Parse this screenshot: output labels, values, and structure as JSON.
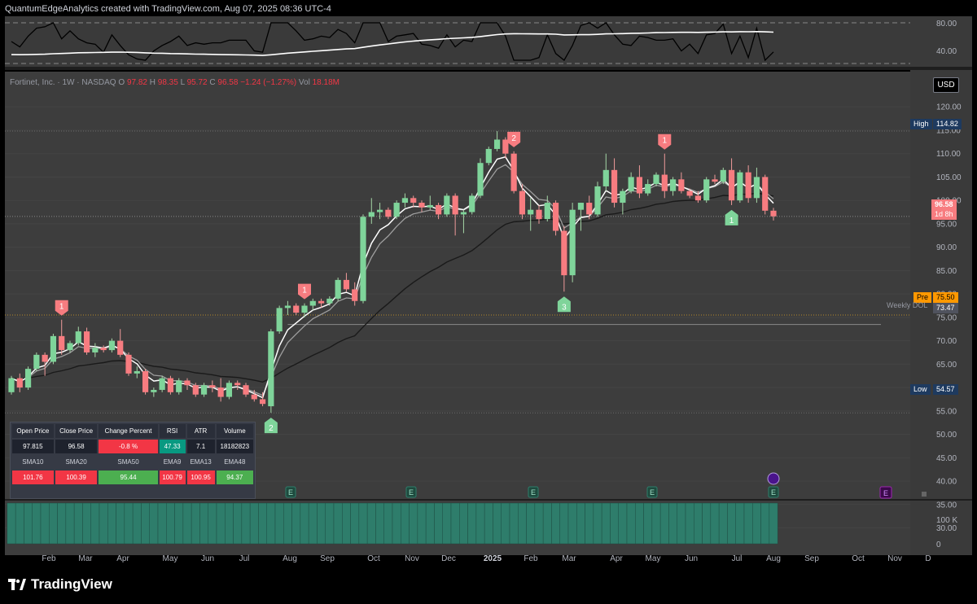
{
  "header": {
    "caption": "QuantumEdgeAnalytics created with TradingView.com, Aug 07, 2025 08:36 UTC-4"
  },
  "symbol": {
    "title": "Fortinet, Inc. · 1W · NASDAQ",
    "o_label": "O",
    "o_val": "97.82",
    "h_label": "H",
    "h_val": "98.35",
    "l_label": "L",
    "l_val": "95.72",
    "c_label": "C",
    "c_val": "96.58 −1.24 (−1.27%)",
    "vol_label": "Vol",
    "vol_val": "18.18M"
  },
  "currency": "USD",
  "price_labels": {
    "high_label": "High",
    "high_value": "114.82",
    "low_label": "Low",
    "low_value": "54.57",
    "last_value": "96.58",
    "last_countdown": "1d 8h",
    "pre_label": "Pre",
    "pre_value": "75.50",
    "dol_label": "Weekly DOL",
    "dol_value": "73.47"
  },
  "colors": {
    "up": "#4caf50",
    "down": "#f23645",
    "up_soft": "#7fd49a",
    "down_soft": "#f77c80",
    "ema_fast": "#ffffff",
    "ema_slow": "#9e9e9e",
    "sma_long": "#1a1a1a",
    "volume": "#2e7d6b",
    "high_box": "#1e3a5f"
  },
  "stats_table": {
    "headers": [
      "Open Price",
      "Close Price",
      "Change Percent",
      "RSI",
      "ATR",
      "Volume"
    ],
    "values": [
      "97.815",
      "96.58",
      "-0.8 %",
      "47.33",
      "7.1",
      "18182823"
    ],
    "ma_headers": [
      "SMA10",
      "SMA20",
      "SMA50",
      "EMA9",
      "EMA13",
      "EMA48"
    ],
    "ma_values": [
      "101.76",
      "100.39",
      "95.44",
      "100.79",
      "100.95",
      "94.37"
    ]
  },
  "brand": "TradingView",
  "chart_data": {
    "type": "candlestick",
    "title": "Fortinet, Inc. · 1W · NASDAQ",
    "y_ticks": [
      30,
      35,
      40,
      45,
      50,
      55,
      60,
      65,
      70,
      75,
      80,
      85,
      90,
      95,
      100,
      105,
      110,
      115,
      120
    ],
    "ylim": [
      28,
      123
    ],
    "x_labels": [
      "Feb",
      "Mar",
      "Apr",
      "May",
      "Jun",
      "Jul",
      "Aug",
      "Sep",
      "Oct",
      "Nov",
      "Dec",
      "2025",
      "Feb",
      "Mar",
      "Apr",
      "May",
      "Jun",
      "Jul",
      "Aug",
      "Sep",
      "Oct",
      "Nov",
      "D"
    ],
    "volume_axis": [
      "100 K",
      "0"
    ],
    "indicator_axis": [
      "80.00",
      "40.00"
    ],
    "candles": [
      [
        59.0,
        62.5,
        58.5,
        62.0
      ],
      [
        62.0,
        63.0,
        59.0,
        60.0
      ],
      [
        60.0,
        64.5,
        59.5,
        64.0
      ],
      [
        64.0,
        67.5,
        63.5,
        67.0
      ],
      [
        67.0,
        67.5,
        62.5,
        65.5
      ],
      [
        65.5,
        71.5,
        65.0,
        71.0
      ],
      [
        71.0,
        74.5,
        67.0,
        68.0
      ],
      [
        68.0,
        70.0,
        67.5,
        69.5
      ],
      [
        69.5,
        73.0,
        69.0,
        72.0
      ],
      [
        72.0,
        72.8,
        67.0,
        67.5
      ],
      [
        67.5,
        69.5,
        66.5,
        68.5
      ],
      [
        68.5,
        69.0,
        67.5,
        68.0
      ],
      [
        68.0,
        70.5,
        67.5,
        70.0
      ],
      [
        70.0,
        72.5,
        66.5,
        67.0
      ],
      [
        67.0,
        67.5,
        62.5,
        63.0
      ],
      [
        63.0,
        64.5,
        62.0,
        63.5
      ],
      [
        63.5,
        64.0,
        58.5,
        59.0
      ],
      [
        59.0,
        60.0,
        58.0,
        59.5
      ],
      [
        59.5,
        62.5,
        59.0,
        62.0
      ],
      [
        62.0,
        62.5,
        58.5,
        59.0
      ],
      [
        59.0,
        62.0,
        58.5,
        61.5
      ],
      [
        61.5,
        62.0,
        59.5,
        60.5
      ],
      [
        60.5,
        61.0,
        58.0,
        58.5
      ],
      [
        58.5,
        61.0,
        58.0,
        60.5
      ],
      [
        60.5,
        61.5,
        59.0,
        60.0
      ],
      [
        60.0,
        62.0,
        57.0,
        58.0
      ],
      [
        58.0,
        61.5,
        57.5,
        61.0
      ],
      [
        61.0,
        61.5,
        59.5,
        60.5
      ],
      [
        60.5,
        61.0,
        58.0,
        58.5
      ],
      [
        58.5,
        59.5,
        57.0,
        57.5
      ],
      [
        57.5,
        59.0,
        56.0,
        56.5
      ],
      [
        56.0,
        72.5,
        54.6,
        72.0
      ],
      [
        72.0,
        77.5,
        71.5,
        77.0
      ],
      [
        77.0,
        78.5,
        75.5,
        77.5
      ],
      [
        77.5,
        78.0,
        75.5,
        76.0
      ],
      [
        76.0,
        78.0,
        75.0,
        77.5
      ],
      [
        77.5,
        79.0,
        76.5,
        78.5
      ],
      [
        78.5,
        79.0,
        77.0,
        78.0
      ],
      [
        78.0,
        79.5,
        77.5,
        79.0
      ],
      [
        79.0,
        83.5,
        78.5,
        83.0
      ],
      [
        83.0,
        84.5,
        80.5,
        81.0
      ],
      [
        81.0,
        82.5,
        77.5,
        78.5
      ],
      [
        78.5,
        97.0,
        78.0,
        96.5
      ],
      [
        96.5,
        100.5,
        95.0,
        97.5
      ],
      [
        97.5,
        99.5,
        96.0,
        98.0
      ],
      [
        98.0,
        98.5,
        96.0,
        96.5
      ],
      [
        96.5,
        100.0,
        96.0,
        99.5
      ],
      [
        99.5,
        101.5,
        98.5,
        100.5
      ],
      [
        100.5,
        101.0,
        98.5,
        99.5
      ],
      [
        99.5,
        100.0,
        97.5,
        98.5
      ],
      [
        98.5,
        101.0,
        98.0,
        99.0
      ],
      [
        99.0,
        99.5,
        96.0,
        97.0
      ],
      [
        97.0,
        101.5,
        96.5,
        101.0
      ],
      [
        101.0,
        101.5,
        92.5,
        97.0
      ],
      [
        97.0,
        98.0,
        93.0,
        97.5
      ],
      [
        97.5,
        101.5,
        97.0,
        101.0
      ],
      [
        101.0,
        109.0,
        100.5,
        108.0
      ],
      [
        108.0,
        111.5,
        107.5,
        111.0
      ],
      [
        111.0,
        114.8,
        110.5,
        113.0
      ],
      [
        113.0,
        113.5,
        109.0,
        110.0
      ],
      [
        110.0,
        110.5,
        101.5,
        102.0
      ],
      [
        102.0,
        103.5,
        96.0,
        97.0
      ],
      [
        97.0,
        100.5,
        93.5,
        98.0
      ],
      [
        98.0,
        99.0,
        95.0,
        96.0
      ],
      [
        96.0,
        101.0,
        95.5,
        99.5
      ],
      [
        99.5,
        100.0,
        92.5,
        93.5
      ],
      [
        93.5,
        94.5,
        80.5,
        84.0
      ],
      [
        84.0,
        99.5,
        82.5,
        98.0
      ],
      [
        98.0,
        99.5,
        93.5,
        99.5
      ],
      [
        99.5,
        101.0,
        96.0,
        97.0
      ],
      [
        97.0,
        104.0,
        96.5,
        103.0
      ],
      [
        103.0,
        110.0,
        102.0,
        106.5
      ],
      [
        106.5,
        109.0,
        98.5,
        99.5
      ],
      [
        99.5,
        102.5,
        97.0,
        102.0
      ],
      [
        102.0,
        106.0,
        101.5,
        105.0
      ],
      [
        105.0,
        107.5,
        100.5,
        101.5
      ],
      [
        101.5,
        104.5,
        101.0,
        103.5
      ],
      [
        103.5,
        106.0,
        103.0,
        105.5
      ],
      [
        105.5,
        110.0,
        100.5,
        102.0
      ],
      [
        102.0,
        105.0,
        101.0,
        104.5
      ],
      [
        104.5,
        106.0,
        101.5,
        102.0
      ],
      [
        102.0,
        102.5,
        100.5,
        101.0
      ],
      [
        101.0,
        102.0,
        99.5,
        100.0
      ],
      [
        100.0,
        105.0,
        99.5,
        104.5
      ],
      [
        104.5,
        105.5,
        103.5,
        104.0
      ],
      [
        104.0,
        107.0,
        103.5,
        106.5
      ],
      [
        106.5,
        109.0,
        99.0,
        100.0
      ],
      [
        100.0,
        106.5,
        99.5,
        106.0
      ],
      [
        106.0,
        107.5,
        99.5,
        100.5
      ],
      [
        100.5,
        107.0,
        99.5,
        105.0
      ],
      [
        105.0,
        105.5,
        97.0,
        97.8
      ],
      [
        97.8,
        98.4,
        95.7,
        96.6
      ]
    ],
    "signals": [
      {
        "i": 6,
        "dir": "down",
        "label": "1"
      },
      {
        "i": 31,
        "dir": "up",
        "label": "2"
      },
      {
        "i": 35,
        "dir": "down",
        "label": "1"
      },
      {
        "i": 60,
        "dir": "down",
        "label": "2"
      },
      {
        "i": 66,
        "dir": "up",
        "label": "3"
      },
      {
        "i": 78,
        "dir": "down",
        "label": "1"
      },
      {
        "i": 86,
        "dir": "up",
        "label": "1"
      }
    ],
    "earnings_markers": [
      "E",
      "E",
      "E",
      "E",
      "E",
      "E",
      "E"
    ]
  }
}
